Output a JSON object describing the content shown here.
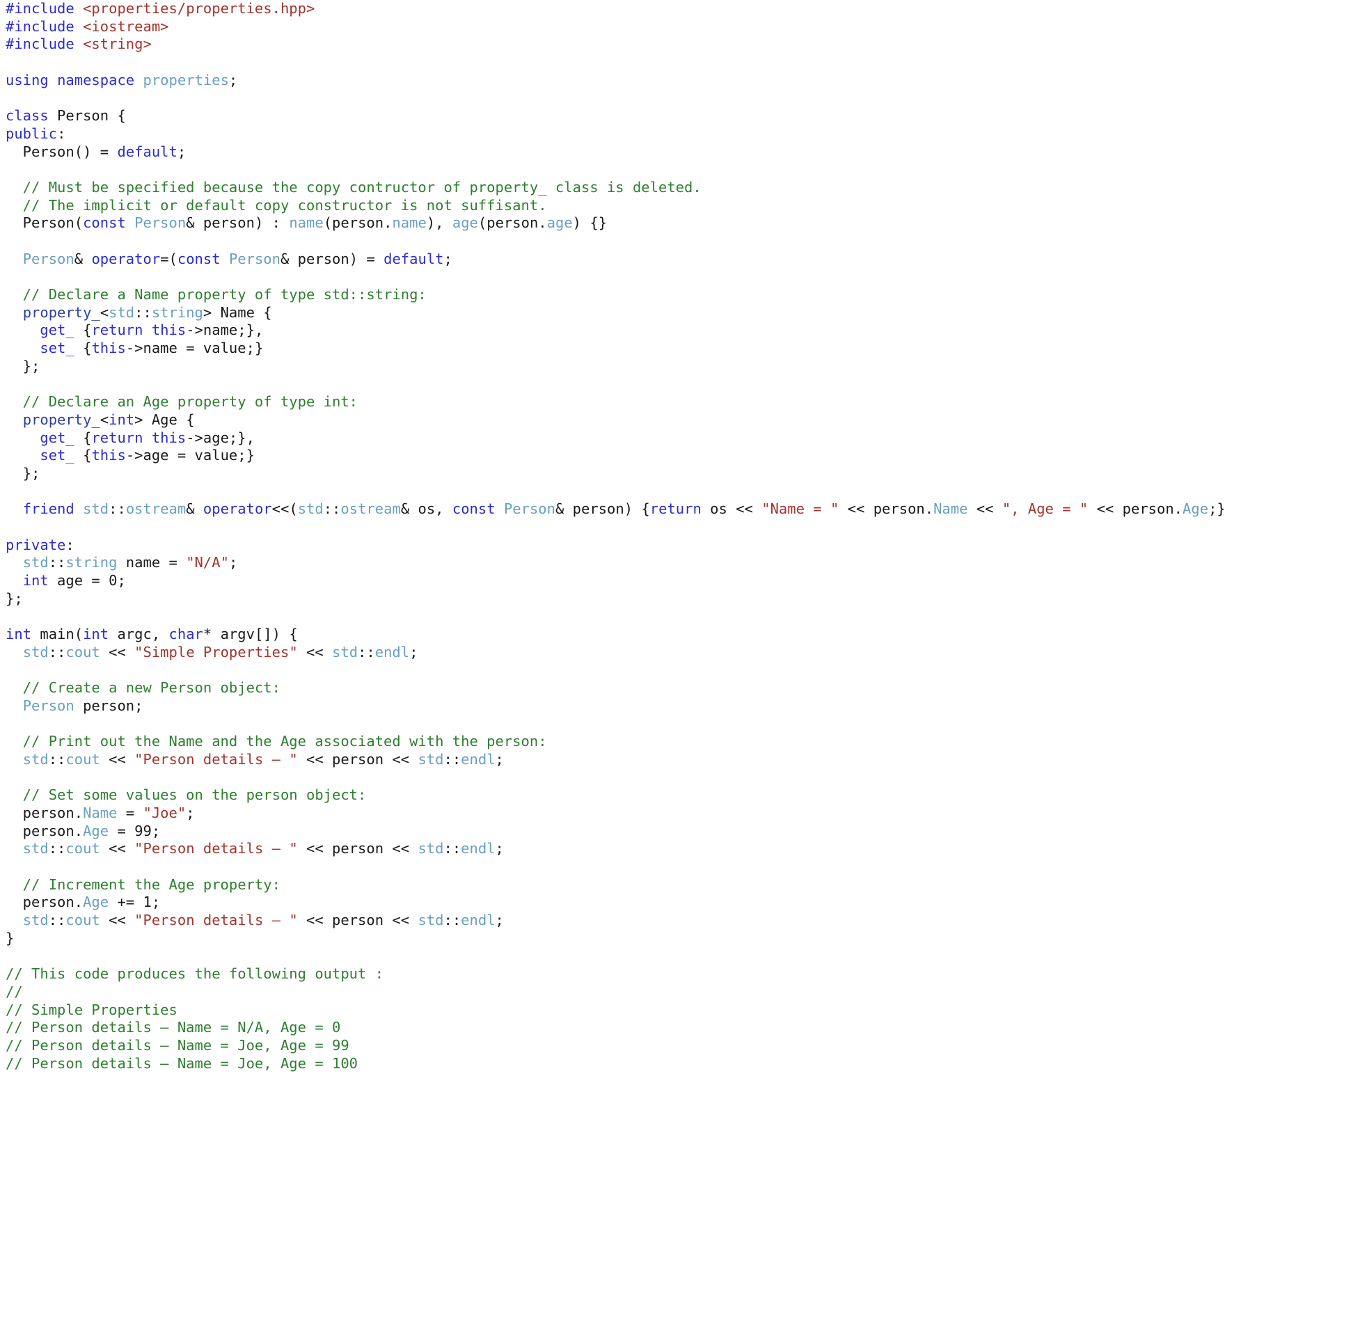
{
  "document": {
    "language": "C++",
    "background_color": "#ffffff",
    "colors": {
      "keyword": "#2b2bd6",
      "string": "#a3342c",
      "comment": "#2f7f2f",
      "type": "#6a9fc0",
      "property_template": "#2b3fa8",
      "plain": "#1a1a1a"
    },
    "lines": [
      [
        {
          "t": "#include",
          "c": "kw"
        },
        {
          "t": " ",
          "c": "pln"
        },
        {
          "t": "<properties/properties.hpp>",
          "c": "str"
        }
      ],
      [
        {
          "t": "#include",
          "c": "kw"
        },
        {
          "t": " ",
          "c": "pln"
        },
        {
          "t": "<iostream>",
          "c": "str"
        }
      ],
      [
        {
          "t": "#include",
          "c": "kw"
        },
        {
          "t": " ",
          "c": "pln"
        },
        {
          "t": "<string>",
          "c": "str"
        }
      ],
      [],
      [
        {
          "t": "using",
          "c": "kw"
        },
        {
          "t": " ",
          "c": "pln"
        },
        {
          "t": "namespace",
          "c": "kw"
        },
        {
          "t": " ",
          "c": "pln"
        },
        {
          "t": "properties",
          "c": "typ"
        },
        {
          "t": ";",
          "c": "pln"
        }
      ],
      [],
      [
        {
          "t": "class",
          "c": "kw"
        },
        {
          "t": " Person {",
          "c": "pln"
        }
      ],
      [
        {
          "t": "public",
          "c": "kw"
        },
        {
          "t": ":",
          "c": "pln"
        }
      ],
      [
        {
          "t": "  Person() = ",
          "c": "pln"
        },
        {
          "t": "default",
          "c": "kw"
        },
        {
          "t": ";",
          "c": "pln"
        }
      ],
      [],
      [
        {
          "t": "  // Must be specified because the copy contructor of property_ class is deleted.",
          "c": "cmt"
        }
      ],
      [
        {
          "t": "  // The implicit or default copy constructor is not suffisant.",
          "c": "cmt"
        }
      ],
      [
        {
          "t": "  Person(",
          "c": "pln"
        },
        {
          "t": "const",
          "c": "kw"
        },
        {
          "t": " ",
          "c": "pln"
        },
        {
          "t": "Person",
          "c": "typ"
        },
        {
          "t": "& person) : ",
          "c": "pln"
        },
        {
          "t": "name",
          "c": "typ"
        },
        {
          "t": "(person.",
          "c": "pln"
        },
        {
          "t": "name",
          "c": "typ"
        },
        {
          "t": "), ",
          "c": "pln"
        },
        {
          "t": "age",
          "c": "typ"
        },
        {
          "t": "(person.",
          "c": "pln"
        },
        {
          "t": "age",
          "c": "typ"
        },
        {
          "t": ") {}",
          "c": "pln"
        }
      ],
      [],
      [
        {
          "t": "  ",
          "c": "pln"
        },
        {
          "t": "Person",
          "c": "typ"
        },
        {
          "t": "& ",
          "c": "pln"
        },
        {
          "t": "operator",
          "c": "kw"
        },
        {
          "t": "=(",
          "c": "pln"
        },
        {
          "t": "const",
          "c": "kw"
        },
        {
          "t": " ",
          "c": "pln"
        },
        {
          "t": "Person",
          "c": "typ"
        },
        {
          "t": "& person) = ",
          "c": "pln"
        },
        {
          "t": "default",
          "c": "kw"
        },
        {
          "t": ";",
          "c": "pln"
        }
      ],
      [],
      [
        {
          "t": "  // Declare a Name property of type std::string:",
          "c": "cmt"
        }
      ],
      [
        {
          "t": "  ",
          "c": "pln"
        },
        {
          "t": "property_",
          "c": "prop"
        },
        {
          "t": "<",
          "c": "pln"
        },
        {
          "t": "std",
          "c": "typ"
        },
        {
          "t": "::",
          "c": "pln"
        },
        {
          "t": "string",
          "c": "typ"
        },
        {
          "t": "> Name {",
          "c": "pln"
        }
      ],
      [
        {
          "t": "    ",
          "c": "pln"
        },
        {
          "t": "get_",
          "c": "kw"
        },
        {
          "t": " {",
          "c": "pln"
        },
        {
          "t": "return",
          "c": "kw"
        },
        {
          "t": " ",
          "c": "pln"
        },
        {
          "t": "this",
          "c": "kw"
        },
        {
          "t": "->name;},",
          "c": "pln"
        }
      ],
      [
        {
          "t": "    ",
          "c": "pln"
        },
        {
          "t": "set_",
          "c": "kw"
        },
        {
          "t": " {",
          "c": "pln"
        },
        {
          "t": "this",
          "c": "kw"
        },
        {
          "t": "->name = value;}",
          "c": "pln"
        }
      ],
      [
        {
          "t": "  };",
          "c": "pln"
        }
      ],
      [],
      [
        {
          "t": "  // Declare an Age property of type int:",
          "c": "cmt"
        }
      ],
      [
        {
          "t": "  ",
          "c": "pln"
        },
        {
          "t": "property_",
          "c": "prop"
        },
        {
          "t": "<",
          "c": "pln"
        },
        {
          "t": "int",
          "c": "kw"
        },
        {
          "t": "> Age {",
          "c": "pln"
        }
      ],
      [
        {
          "t": "    ",
          "c": "pln"
        },
        {
          "t": "get_",
          "c": "kw"
        },
        {
          "t": " {",
          "c": "pln"
        },
        {
          "t": "return",
          "c": "kw"
        },
        {
          "t": " ",
          "c": "pln"
        },
        {
          "t": "this",
          "c": "kw"
        },
        {
          "t": "->age;},",
          "c": "pln"
        }
      ],
      [
        {
          "t": "    ",
          "c": "pln"
        },
        {
          "t": "set_",
          "c": "kw"
        },
        {
          "t": " {",
          "c": "pln"
        },
        {
          "t": "this",
          "c": "kw"
        },
        {
          "t": "->age = value;}",
          "c": "pln"
        }
      ],
      [
        {
          "t": "  };",
          "c": "pln"
        }
      ],
      [],
      [
        {
          "t": "  ",
          "c": "pln"
        },
        {
          "t": "friend",
          "c": "kw"
        },
        {
          "t": " ",
          "c": "pln"
        },
        {
          "t": "std",
          "c": "typ"
        },
        {
          "t": "::",
          "c": "pln"
        },
        {
          "t": "ostream",
          "c": "typ"
        },
        {
          "t": "& ",
          "c": "pln"
        },
        {
          "t": "operator",
          "c": "kw"
        },
        {
          "t": "<<(",
          "c": "pln"
        },
        {
          "t": "std",
          "c": "typ"
        },
        {
          "t": "::",
          "c": "pln"
        },
        {
          "t": "ostream",
          "c": "typ"
        },
        {
          "t": "& os, ",
          "c": "pln"
        },
        {
          "t": "const",
          "c": "kw"
        },
        {
          "t": " ",
          "c": "pln"
        },
        {
          "t": "Person",
          "c": "typ"
        },
        {
          "t": "& person) {",
          "c": "pln"
        },
        {
          "t": "return",
          "c": "kw"
        },
        {
          "t": " os << ",
          "c": "pln"
        },
        {
          "t": "\"Name = \"",
          "c": "str"
        },
        {
          "t": " << person.",
          "c": "pln"
        },
        {
          "t": "Name",
          "c": "typ"
        },
        {
          "t": " << ",
          "c": "pln"
        },
        {
          "t": "\", Age = \"",
          "c": "str"
        },
        {
          "t": " << person.",
          "c": "pln"
        },
        {
          "t": "Age",
          "c": "typ"
        },
        {
          "t": ";}",
          "c": "pln"
        }
      ],
      [],
      [
        {
          "t": "private",
          "c": "kw"
        },
        {
          "t": ":",
          "c": "pln"
        }
      ],
      [
        {
          "t": "  ",
          "c": "pln"
        },
        {
          "t": "std",
          "c": "typ"
        },
        {
          "t": "::",
          "c": "pln"
        },
        {
          "t": "string",
          "c": "typ"
        },
        {
          "t": " name = ",
          "c": "pln"
        },
        {
          "t": "\"N/A\"",
          "c": "str"
        },
        {
          "t": ";",
          "c": "pln"
        }
      ],
      [
        {
          "t": "  ",
          "c": "pln"
        },
        {
          "t": "int",
          "c": "kw"
        },
        {
          "t": " age = 0;",
          "c": "pln"
        }
      ],
      [
        {
          "t": "};",
          "c": "pln"
        }
      ],
      [],
      [
        {
          "t": "int",
          "c": "kw"
        },
        {
          "t": " main(",
          "c": "pln"
        },
        {
          "t": "int",
          "c": "kw"
        },
        {
          "t": " argc, ",
          "c": "pln"
        },
        {
          "t": "char",
          "c": "kw"
        },
        {
          "t": "* argv[]) {",
          "c": "pln"
        }
      ],
      [
        {
          "t": "  ",
          "c": "pln"
        },
        {
          "t": "std",
          "c": "typ"
        },
        {
          "t": "::",
          "c": "pln"
        },
        {
          "t": "cout",
          "c": "typ"
        },
        {
          "t": " << ",
          "c": "pln"
        },
        {
          "t": "\"Simple Properties\"",
          "c": "str"
        },
        {
          "t": " << ",
          "c": "pln"
        },
        {
          "t": "std",
          "c": "typ"
        },
        {
          "t": "::",
          "c": "pln"
        },
        {
          "t": "endl",
          "c": "typ"
        },
        {
          "t": ";",
          "c": "pln"
        }
      ],
      [],
      [
        {
          "t": "  // Create a new Person object:",
          "c": "cmt"
        }
      ],
      [
        {
          "t": "  ",
          "c": "pln"
        },
        {
          "t": "Person",
          "c": "typ"
        },
        {
          "t": " person;",
          "c": "pln"
        }
      ],
      [],
      [
        {
          "t": "  // Print out the Name and the Age associated with the person:",
          "c": "cmt"
        }
      ],
      [
        {
          "t": "  ",
          "c": "pln"
        },
        {
          "t": "std",
          "c": "typ"
        },
        {
          "t": "::",
          "c": "pln"
        },
        {
          "t": "cout",
          "c": "typ"
        },
        {
          "t": " << ",
          "c": "pln"
        },
        {
          "t": "\"Person details – \"",
          "c": "str"
        },
        {
          "t": " << person << ",
          "c": "pln"
        },
        {
          "t": "std",
          "c": "typ"
        },
        {
          "t": "::",
          "c": "pln"
        },
        {
          "t": "endl",
          "c": "typ"
        },
        {
          "t": ";",
          "c": "pln"
        }
      ],
      [],
      [
        {
          "t": "  // Set some values on the person object:",
          "c": "cmt"
        }
      ],
      [
        {
          "t": "  person.",
          "c": "pln"
        },
        {
          "t": "Name",
          "c": "typ"
        },
        {
          "t": " = ",
          "c": "pln"
        },
        {
          "t": "\"Joe\"",
          "c": "str"
        },
        {
          "t": ";",
          "c": "pln"
        }
      ],
      [
        {
          "t": "  person.",
          "c": "pln"
        },
        {
          "t": "Age",
          "c": "typ"
        },
        {
          "t": " = 99;",
          "c": "pln"
        }
      ],
      [
        {
          "t": "  ",
          "c": "pln"
        },
        {
          "t": "std",
          "c": "typ"
        },
        {
          "t": "::",
          "c": "pln"
        },
        {
          "t": "cout",
          "c": "typ"
        },
        {
          "t": " << ",
          "c": "pln"
        },
        {
          "t": "\"Person details – \"",
          "c": "str"
        },
        {
          "t": " << person << ",
          "c": "pln"
        },
        {
          "t": "std",
          "c": "typ"
        },
        {
          "t": "::",
          "c": "pln"
        },
        {
          "t": "endl",
          "c": "typ"
        },
        {
          "t": ";",
          "c": "pln"
        }
      ],
      [],
      [
        {
          "t": "  // Increment the Age property:",
          "c": "cmt"
        }
      ],
      [
        {
          "t": "  person.",
          "c": "pln"
        },
        {
          "t": "Age",
          "c": "typ"
        },
        {
          "t": " += 1;",
          "c": "pln"
        }
      ],
      [
        {
          "t": "  ",
          "c": "pln"
        },
        {
          "t": "std",
          "c": "typ"
        },
        {
          "t": "::",
          "c": "pln"
        },
        {
          "t": "cout",
          "c": "typ"
        },
        {
          "t": " << ",
          "c": "pln"
        },
        {
          "t": "\"Person details – \"",
          "c": "str"
        },
        {
          "t": " << person << ",
          "c": "pln"
        },
        {
          "t": "std",
          "c": "typ"
        },
        {
          "t": "::",
          "c": "pln"
        },
        {
          "t": "endl",
          "c": "typ"
        },
        {
          "t": ";",
          "c": "pln"
        }
      ],
      [
        {
          "t": "}",
          "c": "pln"
        }
      ],
      [],
      [
        {
          "t": "// This code produces the following output :",
          "c": "cmt"
        }
      ],
      [
        {
          "t": "//",
          "c": "cmt"
        }
      ],
      [
        {
          "t": "// Simple Properties",
          "c": "cmt"
        }
      ],
      [
        {
          "t": "// Person details – Name = N/A, Age = 0",
          "c": "cmt"
        }
      ],
      [
        {
          "t": "// Person details – Name = Joe, Age = 99",
          "c": "cmt"
        }
      ],
      [
        {
          "t": "// Person details – Name = Joe, Age = 100",
          "c": "cmt"
        }
      ]
    ]
  }
}
